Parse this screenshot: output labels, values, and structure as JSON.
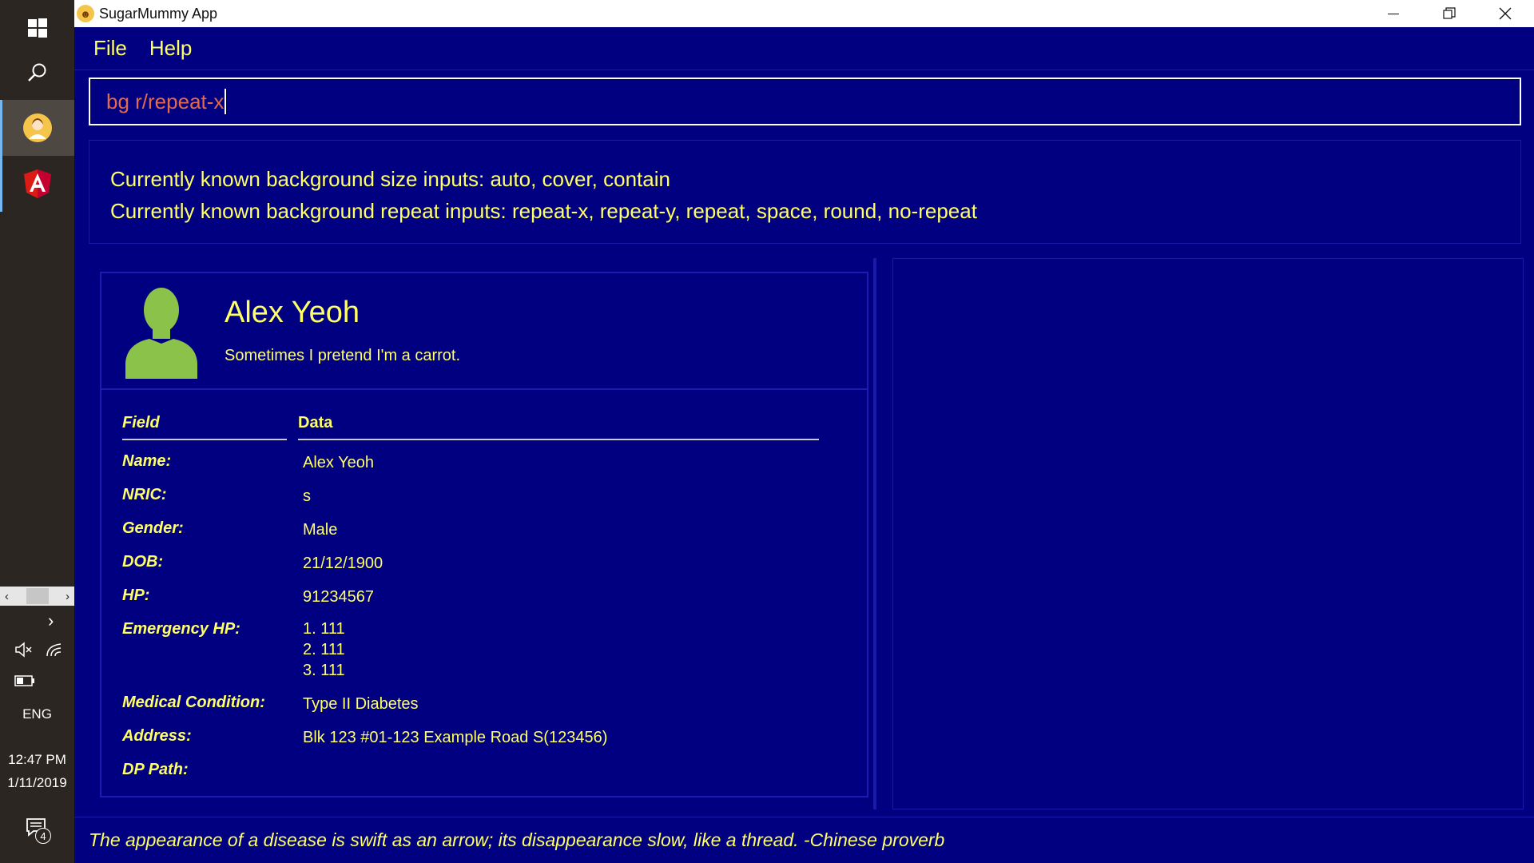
{
  "taskbar": {
    "time": "12:47 PM",
    "date": "1/11/2019",
    "language": "ENG",
    "notification_count": "4",
    "icons": [
      "windows-start-icon",
      "search-icon",
      "sugarmummy-app-icon",
      "angular-app-icon",
      "show-hidden-icons-chevron",
      "volume-muted-icon",
      "wifi-icon",
      "battery-icon",
      "action-center-icon"
    ]
  },
  "window": {
    "title": "SugarMummy App"
  },
  "menu": {
    "items": [
      "File",
      "Help"
    ]
  },
  "command": {
    "value": "bg r/repeat-x"
  },
  "result": {
    "lines": [
      "Currently known background size inputs: auto, cover, contain",
      "Currently known background repeat inputs: repeat-x, repeat-y, repeat, space, round, no-repeat"
    ]
  },
  "profile": {
    "name": "Alex Yeoh",
    "bio": "Sometimes I pretend I'm a carrot."
  },
  "details": {
    "header_field": "Field",
    "header_data": "Data",
    "rows": [
      {
        "label": "Name:",
        "value": "Alex Yeoh"
      },
      {
        "label": "NRIC:",
        "value": "s"
      },
      {
        "label": "Gender:",
        "value": "Male"
      },
      {
        "label": "DOB:",
        "value": "21/12/1900"
      },
      {
        "label": "HP:",
        "value": "91234567"
      },
      {
        "label": "Emergency HP:",
        "value_lines": [
          "1. 111",
          "2. 111",
          "3. 111"
        ]
      },
      {
        "label": "Medical Condition:",
        "value": "Type II Diabetes"
      },
      {
        "label": "Address:",
        "value": "Blk 123 #01-123 Example Road S(123456)"
      },
      {
        "label": "DP Path:",
        "value": ""
      }
    ]
  },
  "quote": "The appearance of a disease is swift as an arrow; its disappearance slow, like a thread. -Chinese proverb",
  "colors": {
    "background": "#000080",
    "text": "#ffff66",
    "command_text": "#e36a4a",
    "avatar": "#8bc34a",
    "taskbar": "#2b2622"
  }
}
